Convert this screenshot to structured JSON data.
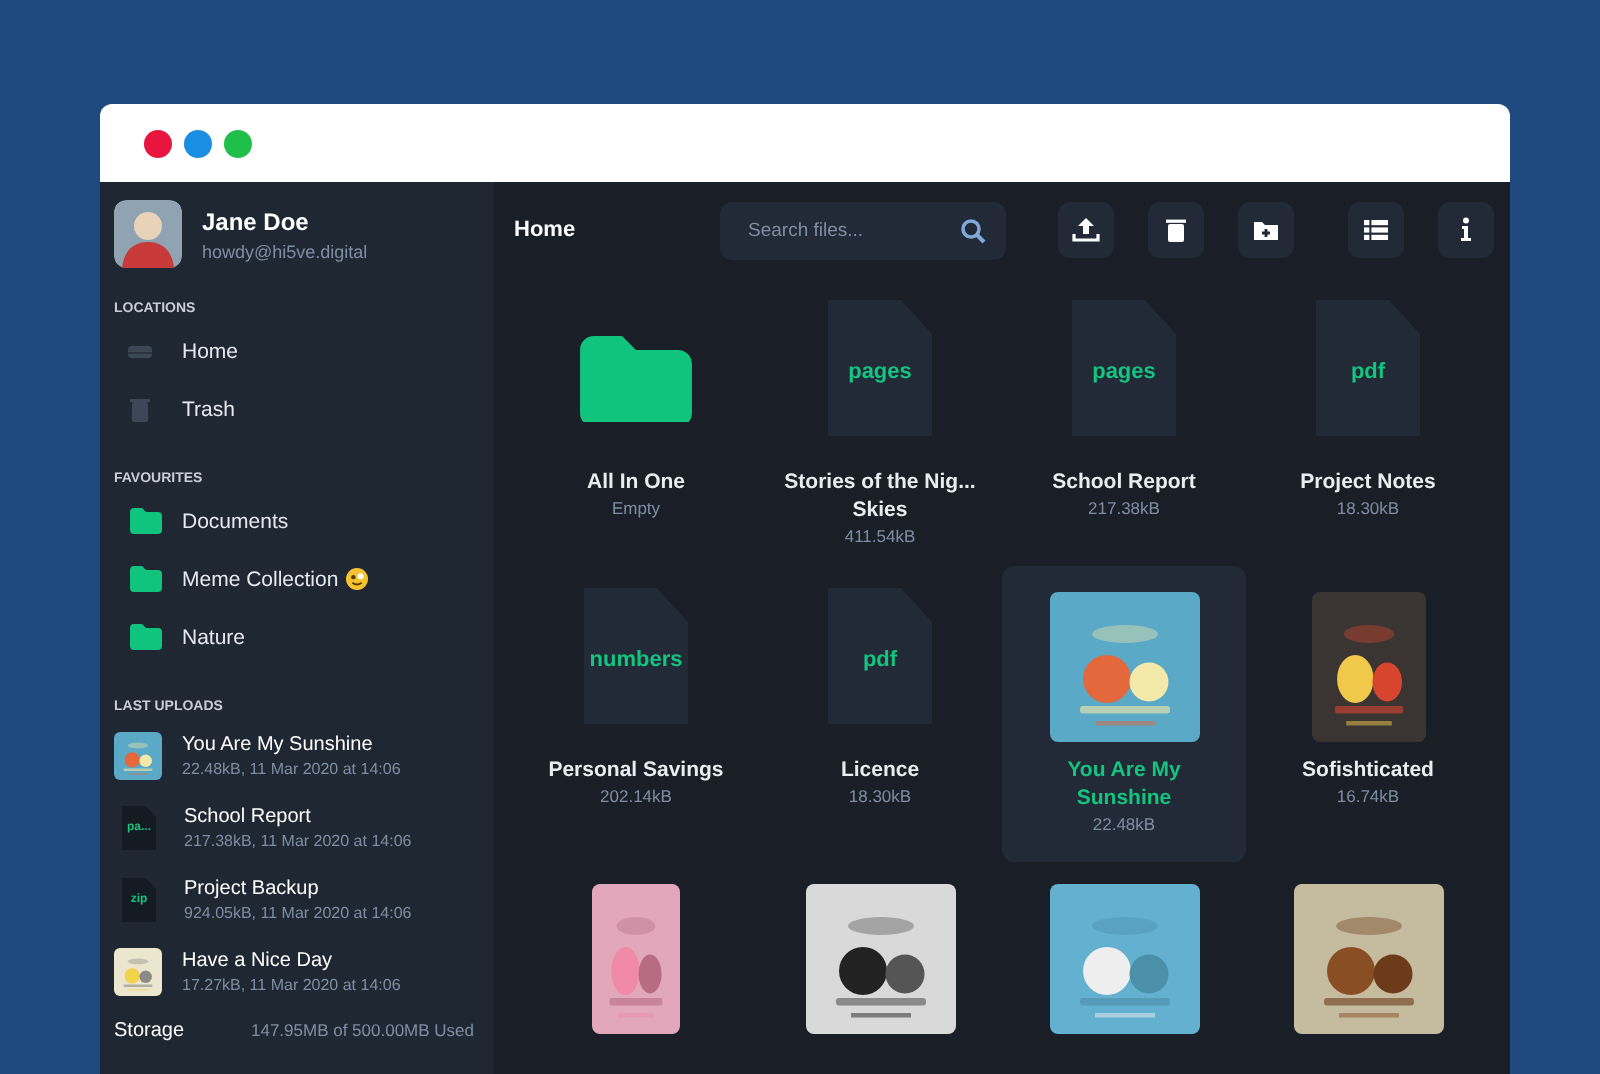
{
  "window": {
    "controls": [
      {
        "kind": "close"
      },
      {
        "kind": "minimize"
      },
      {
        "kind": "maximize"
      }
    ]
  },
  "user": {
    "name": "Jane Doe",
    "email": "howdy@hi5ve.digital"
  },
  "sidebar": {
    "sections": [
      {
        "title": "LOCATIONS",
        "kind": "locations",
        "items": [
          {
            "label": "Home"
          },
          {
            "label": "Trash"
          }
        ]
      },
      {
        "title": "FAVOURITES",
        "kind": "favourites",
        "items": [
          {
            "label": "Documents",
            "emoji": false
          },
          {
            "label": "Meme Collection",
            "emoji": true
          },
          {
            "label": "Nature",
            "emoji": false
          }
        ]
      },
      {
        "title": "LAST UPLOADS",
        "kind": "uploads",
        "items": [
          {
            "name": "You Are My Sunshine",
            "meta": "22.48kB, 11 Mar 2020 at 14:06",
            "kind": "picture"
          },
          {
            "name": "School Report",
            "meta": "217.38kB, 11 Mar 2020 at 14:06",
            "kind": "document",
            "ext": "pa..."
          },
          {
            "name": "Project Backup",
            "meta": "924.05kB, 11 Mar 2020 at 14:06",
            "kind": "document",
            "ext": "zip"
          },
          {
            "name": "Have a Nice Day",
            "meta": "17.27kB, 11 Mar 2020 at 14:06",
            "kind": "picture"
          }
        ]
      }
    ],
    "storage": {
      "label": "Storage",
      "usage": "147.95MB of 500.00MB Used"
    }
  },
  "header": {
    "title": "Home",
    "search": {
      "placeholder": "Search files..."
    },
    "actions": [
      {
        "kind": "upload"
      },
      {
        "kind": "delete"
      },
      {
        "kind": "new-folder"
      },
      {
        "kind": "list"
      },
      {
        "kind": "info"
      }
    ]
  },
  "files": [
    {
      "kind": "folder",
      "name": "All In One",
      "size": "Empty",
      "selected": false
    },
    {
      "kind": "document",
      "ext": "pages",
      "name": "Stories of the Nig... Skies",
      "size": "411.54kB",
      "selected": false
    },
    {
      "kind": "document",
      "ext": "pages",
      "name": "School Report",
      "size": "217.38kB",
      "selected": false
    },
    {
      "kind": "document",
      "ext": "pdf",
      "name": "Project Notes",
      "size": "18.30kB",
      "selected": false
    },
    {
      "kind": "document",
      "ext": "numbers",
      "name": "Personal Savings",
      "size": "202.14kB",
      "selected": false
    },
    {
      "kind": "document",
      "ext": "pdf",
      "name": "Licence",
      "size": "18.30kB",
      "selected": false
    },
    {
      "kind": "picture",
      "name": "You Are My Sunshine",
      "size": "22.48kB",
      "selected": true
    },
    {
      "kind": "picture",
      "name": "Sofishticated",
      "size": "16.74kB",
      "selected": false
    },
    {
      "kind": "picture",
      "selected": false
    },
    {
      "kind": "picture",
      "selected": false
    },
    {
      "kind": "picture",
      "selected": false
    },
    {
      "kind": "picture",
      "selected": false
    }
  ]
}
